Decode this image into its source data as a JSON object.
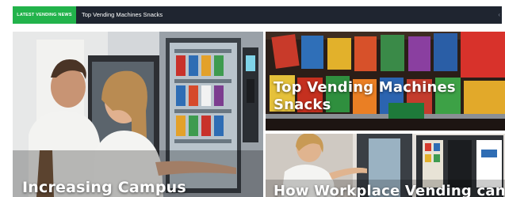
{
  "ticker": {
    "label": "LATEST VENDING NEWS",
    "headline": "Top Vending Machines Snacks",
    "arrow_icon": "chevron-left-icon"
  },
  "cards": {
    "main": {
      "title": "Increasing Campus"
    },
    "top_right": {
      "title": "Top Vending Machines Snacks"
    },
    "bottom_right": {
      "title": "How Workplace Vending can"
    }
  },
  "colors": {
    "ticker_bg": "#1f2530",
    "ticker_label_bg": "#22b34b"
  }
}
